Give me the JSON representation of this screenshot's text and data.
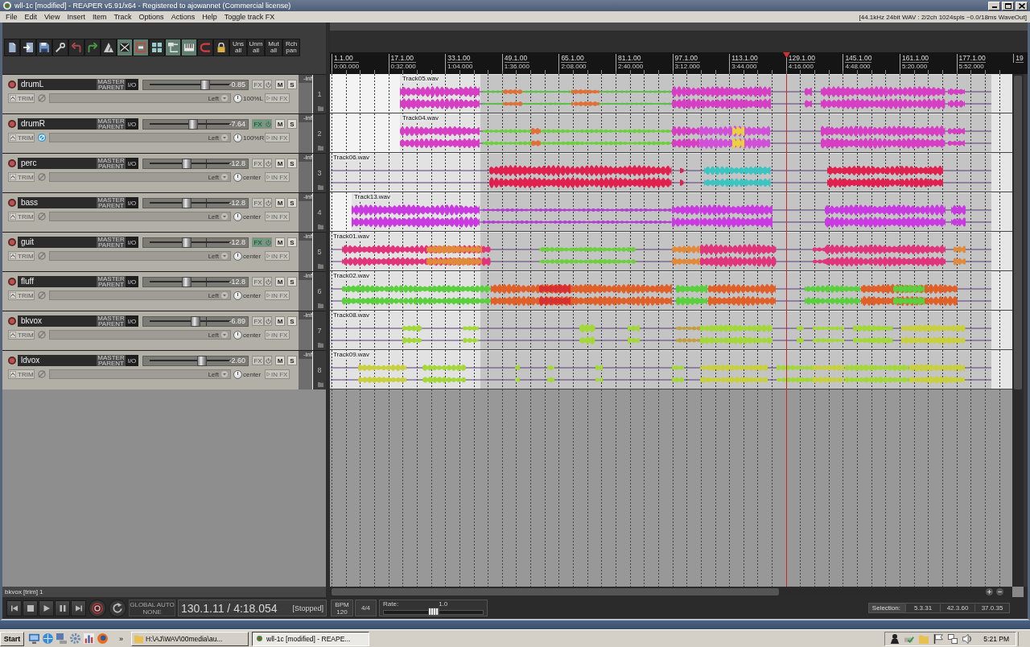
{
  "window": {
    "title": "wll-1c [modified] - REAPER v5.91/x64 - Registered to ajowannet (Commercial license)"
  },
  "menu": [
    "File",
    "Edit",
    "View",
    "Insert",
    "Item",
    "Track",
    "Options",
    "Actions",
    "Help",
    "Toggle track FX"
  ],
  "audio_status": "[44.1kHz 24bit WAV : 2/2ch 1024spls ~0.0/18ms WaveOut]",
  "toolbar": [
    {
      "kind": "icon",
      "on": false
    },
    {
      "kind": "icon",
      "on": false
    },
    {
      "kind": "icon",
      "on": false
    },
    {
      "kind": "icon",
      "on": false
    },
    {
      "kind": "icon",
      "on": false
    },
    {
      "kind": "icon",
      "on": false
    },
    {
      "kind": "icon",
      "on": false
    },
    {
      "kind": "icon",
      "on": true
    },
    {
      "kind": "icon",
      "on": true
    },
    {
      "kind": "icon",
      "on": false
    },
    {
      "kind": "icon",
      "on": true
    },
    {
      "kind": "icon",
      "on": true
    },
    {
      "kind": "icon",
      "on": false
    },
    {
      "kind": "icon",
      "on": false
    },
    {
      "kind": "text",
      "label": "Uns all",
      "on": false
    },
    {
      "kind": "text",
      "label": "Unm all",
      "on": false
    },
    {
      "kind": "text",
      "label": "Mut all",
      "on": false
    },
    {
      "kind": "text",
      "label": "Rch pan",
      "on": false
    }
  ],
  "tracks": [
    {
      "number": "1",
      "name": "drumL",
      "send": "MASTER PARENT",
      "io": "I/O",
      "volume": "-0.85",
      "level": 0.69,
      "fx": "FX",
      "fx_active": false,
      "mute": "M",
      "solo": "S",
      "env": "TRIM",
      "phase_inverted": false,
      "input": "Left",
      "pan": "100%L",
      "input_fx": "IN FX",
      "meter": "-inf",
      "item": "Track05.wav"
    },
    {
      "number": "2",
      "name": "drumR",
      "send": "MASTER PARENT",
      "io": "I/O",
      "volume": "-7.64",
      "level": 0.54,
      "fx": "FX",
      "fx_active": true,
      "mute": "M",
      "solo": "S",
      "env": "TRIM",
      "phase_inverted": true,
      "input": "Left",
      "pan": "100%R",
      "input_fx": "IN FX",
      "meter": "-inf",
      "item": "Track04.wav"
    },
    {
      "number": "3",
      "name": "perc",
      "send": "MASTER PARENT",
      "io": "I/O",
      "volume": "-12.8",
      "level": 0.46,
      "fx": "FX",
      "fx_active": false,
      "mute": "M",
      "solo": "S",
      "env": "TRIM",
      "phase_inverted": false,
      "input": "Left",
      "pan": "center",
      "input_fx": "IN FX",
      "meter": "-inf",
      "item": "Track06.wav"
    },
    {
      "number": "4",
      "name": "bass",
      "send": "MASTER PARENT",
      "io": "I/O",
      "volume": "-12.8",
      "level": 0.46,
      "fx": "FX",
      "fx_active": false,
      "mute": "M",
      "solo": "S",
      "env": "TRIM",
      "phase_inverted": false,
      "input": "Left",
      "pan": "center",
      "input_fx": "IN FX",
      "meter": "-inf",
      "item": "Track13.wav"
    },
    {
      "number": "5",
      "name": "guit",
      "send": "MASTER PARENT",
      "io": "I/O",
      "volume": "-12.8",
      "level": 0.46,
      "fx": "FX",
      "fx_active": true,
      "mute": "M",
      "solo": "S",
      "env": "TRIM",
      "phase_inverted": false,
      "input": "Left",
      "pan": "center",
      "input_fx": "IN FX",
      "meter": "-inf",
      "item": "Track01.wav"
    },
    {
      "number": "6",
      "name": "fluff",
      "send": "MASTER PARENT",
      "io": "I/O",
      "volume": "-12.8",
      "level": 0.46,
      "fx": "FX",
      "fx_active": false,
      "mute": "M",
      "solo": "S",
      "env": "TRIM",
      "phase_inverted": false,
      "input": "Left",
      "pan": "center",
      "input_fx": "IN FX",
      "meter": "-inf",
      "item": "Track02.wav"
    },
    {
      "number": "7",
      "name": "bkvox",
      "send": "MASTER PARENT",
      "io": "I/O",
      "volume": "-6.89",
      "level": 0.57,
      "fx": "FX",
      "fx_active": false,
      "mute": "M",
      "solo": "S",
      "env": "TRIM",
      "phase_inverted": false,
      "input": "Left",
      "pan": "center",
      "input_fx": "IN FX",
      "meter": "-inf",
      "item": "Track08.wav"
    },
    {
      "number": "8",
      "name": "ldvox",
      "send": "MASTER PARENT",
      "io": "I/O",
      "volume": "-2.60",
      "level": 0.65,
      "fx": "FX",
      "fx_active": false,
      "mute": "M",
      "solo": "S",
      "env": "TRIM",
      "phase_inverted": false,
      "input": "Left",
      "pan": "center",
      "input_fx": "IN FX",
      "meter": "-inf",
      "item": "Track09.wav"
    }
  ],
  "ruler": [
    {
      "bar": "1.1.00",
      "time": "0:00.000"
    },
    {
      "bar": "17.1.00",
      "time": "0:32.000"
    },
    {
      "bar": "33.1.00",
      "time": "1:04.000"
    },
    {
      "bar": "49.1.00",
      "time": "1:36.000"
    },
    {
      "bar": "65.1.00",
      "time": "2:08.000"
    },
    {
      "bar": "81.1.00",
      "time": "2:40.000"
    },
    {
      "bar": "97.1.00",
      "time": "3:12.000"
    },
    {
      "bar": "113.1.00",
      "time": "3:44.000"
    },
    {
      "bar": "129.1.00",
      "time": "4:16.000"
    },
    {
      "bar": "145.1.00",
      "time": "4:48.000"
    },
    {
      "bar": "161.1.00",
      "time": "5:20.000"
    },
    {
      "bar": "177.1.00",
      "time": "5:52.000"
    },
    {
      "bar": "19"
    }
  ],
  "status_line": "bkvox [trim] 1",
  "transport": {
    "buttons": [
      {
        "kind": "go-start"
      },
      {
        "kind": "stop"
      },
      {
        "kind": "play"
      },
      {
        "kind": "pause"
      },
      {
        "kind": "go-end"
      },
      {
        "kind": "record"
      },
      {
        "kind": "repeat"
      }
    ],
    "automation_mode": "GLOBAL AUTO",
    "automation_override": "NONE",
    "position": "130.1.11 / 4:18.054",
    "play_state": "[Stopped]",
    "bpm_label": "BPM",
    "bpm": "120",
    "time_signature": "4/4",
    "rate_label": "Rate:",
    "rate": "1.0",
    "rate_slider": {
      "level": 0.5
    }
  },
  "selection": {
    "label": "Selection:",
    "start": "5.3.31",
    "end": "42.3.60",
    "length": "37.0.35"
  },
  "taskbar": {
    "start": "Start",
    "chevron": "»",
    "tasks": [
      {
        "label": "H:\\AJ\\WAV\\00media\\au...",
        "selected": false
      },
      {
        "label": "wll-1c [modified] - REAPE...",
        "selected": true
      }
    ],
    "clock": "5:21 PM"
  }
}
